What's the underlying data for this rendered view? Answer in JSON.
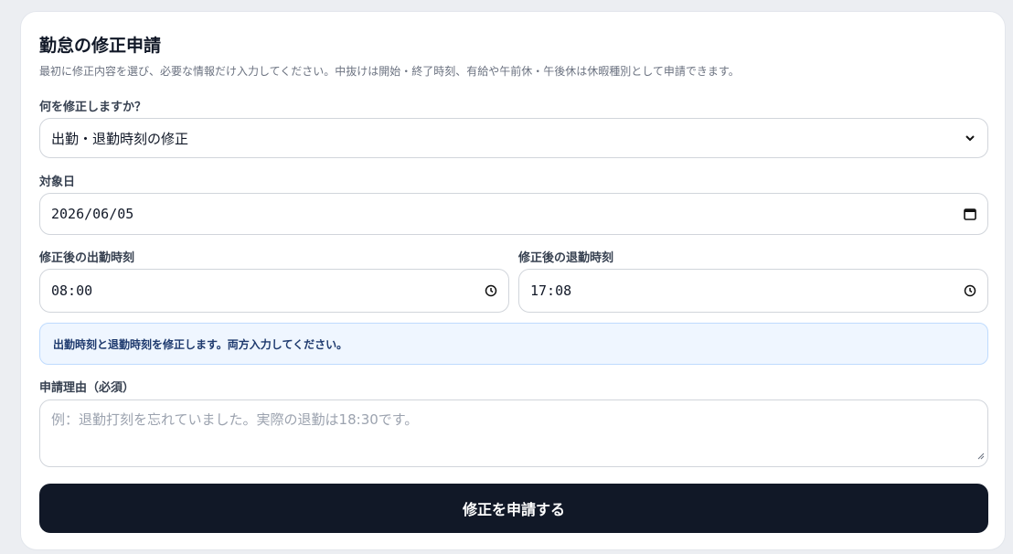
{
  "form": {
    "title": "勤怠の修正申請",
    "description": "最初に修正内容を選び、必要な情報だけ入力してください。中抜けは開始・終了時刻、有給や午前休・午後休は休暇種別として申請できます。",
    "correction_type": {
      "label": "何を修正しますか？",
      "selected": "出勤・退勤時刻の修正"
    },
    "target_date": {
      "label": "対象日",
      "value": "2026/06/05"
    },
    "clock_in": {
      "label": "修正後の出勤時刻",
      "value": "08:00"
    },
    "clock_out": {
      "label": "修正後の退勤時刻",
      "value": "17:08"
    },
    "info_message": "出勤時刻と退勤時刻を修正します。両方入力してください。",
    "reason": {
      "label": "申請理由（必須）",
      "placeholder": "例：退勤打刻を忘れていました。実際の退勤は18:30です。"
    },
    "submit_label": "修正を申請する"
  },
  "colors": {
    "background": "#eceef2",
    "card": "#ffffff",
    "info_background": "#eff6ff",
    "info_border": "#bfdbfe",
    "button": "#111827"
  },
  "icons": [
    "chevron-down-icon",
    "calendar-icon",
    "clock-icon",
    "resize-handle-icon"
  ]
}
